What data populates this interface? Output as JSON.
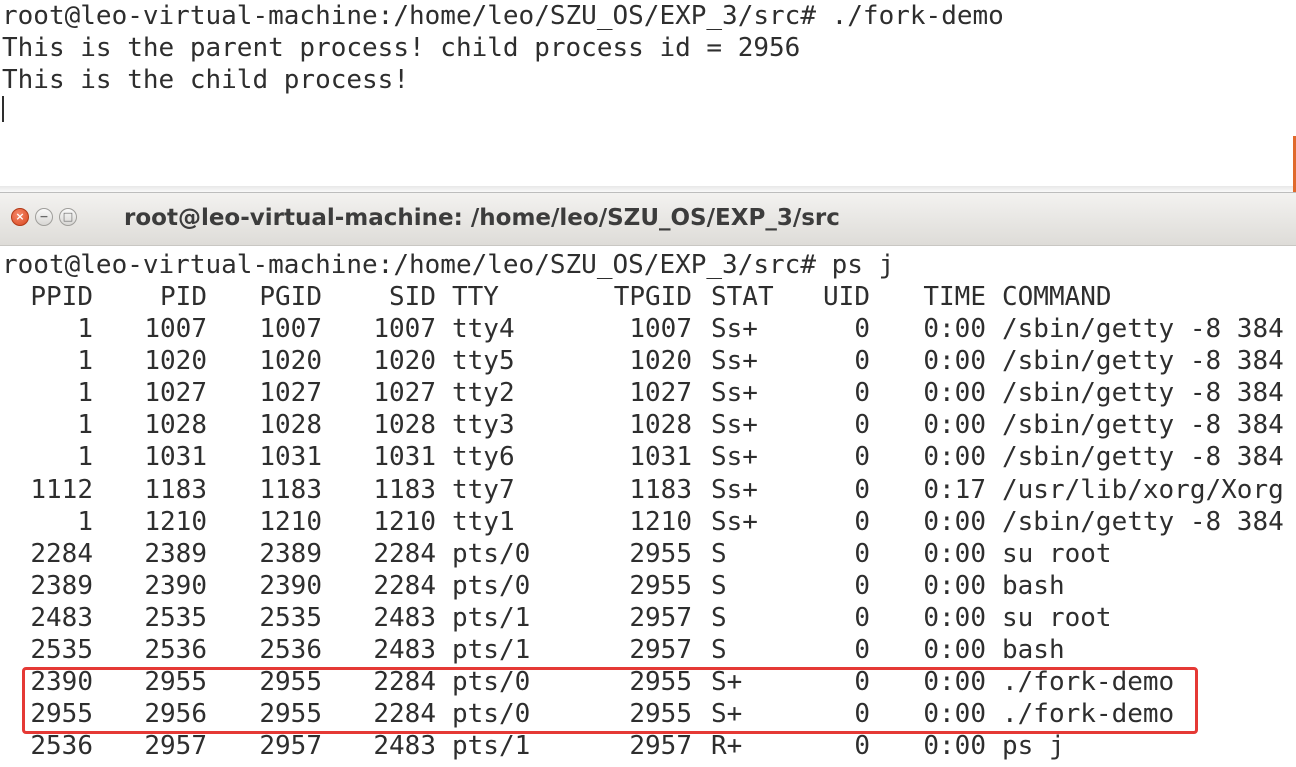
{
  "top_terminal": {
    "lines": [
      "root@leo-virtual-machine:/home/leo/SZU_OS/EXP_3/src# ./fork-demo",
      "This is the parent process! child process id = 2956",
      "This is the child process!"
    ]
  },
  "window": {
    "title": "root@leo-virtual-machine: /home/leo/SZU_OS/EXP_3/src",
    "close_glyph": "×",
    "minimize_glyph": "−",
    "maximize_glyph": "□"
  },
  "terminal": {
    "prompt": "root@leo-virtual-machine:/home/leo/SZU_OS/EXP_3/src# ps j",
    "headers": {
      "ppid": "PPID",
      "pid": "PID",
      "pgid": "PGID",
      "sid": "SID",
      "tty": "TTY",
      "tpgid": "TPGID",
      "stat": "STAT",
      "uid": "UID",
      "time": "TIME",
      "command": "COMMAND"
    },
    "rows": [
      {
        "ppid": "1",
        "pid": "1007",
        "pgid": "1007",
        "sid": "1007",
        "tty": "tty4",
        "tpgid": "1007",
        "stat": "Ss+",
        "uid": "0",
        "time": "0:00",
        "command": "/sbin/getty -8 384"
      },
      {
        "ppid": "1",
        "pid": "1020",
        "pgid": "1020",
        "sid": "1020",
        "tty": "tty5",
        "tpgid": "1020",
        "stat": "Ss+",
        "uid": "0",
        "time": "0:00",
        "command": "/sbin/getty -8 384"
      },
      {
        "ppid": "1",
        "pid": "1027",
        "pgid": "1027",
        "sid": "1027",
        "tty": "tty2",
        "tpgid": "1027",
        "stat": "Ss+",
        "uid": "0",
        "time": "0:00",
        "command": "/sbin/getty -8 384"
      },
      {
        "ppid": "1",
        "pid": "1028",
        "pgid": "1028",
        "sid": "1028",
        "tty": "tty3",
        "tpgid": "1028",
        "stat": "Ss+",
        "uid": "0",
        "time": "0:00",
        "command": "/sbin/getty -8 384"
      },
      {
        "ppid": "1",
        "pid": "1031",
        "pgid": "1031",
        "sid": "1031",
        "tty": "tty6",
        "tpgid": "1031",
        "stat": "Ss+",
        "uid": "0",
        "time": "0:00",
        "command": "/sbin/getty -8 384"
      },
      {
        "ppid": "1112",
        "pid": "1183",
        "pgid": "1183",
        "sid": "1183",
        "tty": "tty7",
        "tpgid": "1183",
        "stat": "Ss+",
        "uid": "0",
        "time": "0:17",
        "command": "/usr/lib/xorg/Xorg"
      },
      {
        "ppid": "1",
        "pid": "1210",
        "pgid": "1210",
        "sid": "1210",
        "tty": "tty1",
        "tpgid": "1210",
        "stat": "Ss+",
        "uid": "0",
        "time": "0:00",
        "command": "/sbin/getty -8 384"
      },
      {
        "ppid": "2284",
        "pid": "2389",
        "pgid": "2389",
        "sid": "2284",
        "tty": "pts/0",
        "tpgid": "2955",
        "stat": "S",
        "uid": "0",
        "time": "0:00",
        "command": "su root"
      },
      {
        "ppid": "2389",
        "pid": "2390",
        "pgid": "2390",
        "sid": "2284",
        "tty": "pts/0",
        "tpgid": "2955",
        "stat": "S",
        "uid": "0",
        "time": "0:00",
        "command": "bash"
      },
      {
        "ppid": "2483",
        "pid": "2535",
        "pgid": "2535",
        "sid": "2483",
        "tty": "pts/1",
        "tpgid": "2957",
        "stat": "S",
        "uid": "0",
        "time": "0:00",
        "command": "su root"
      },
      {
        "ppid": "2535",
        "pid": "2536",
        "pgid": "2536",
        "sid": "2483",
        "tty": "pts/1",
        "tpgid": "2957",
        "stat": "S",
        "uid": "0",
        "time": "0:00",
        "command": "bash"
      },
      {
        "ppid": "2390",
        "pid": "2955",
        "pgid": "2955",
        "sid": "2284",
        "tty": "pts/0",
        "tpgid": "2955",
        "stat": "S+",
        "uid": "0",
        "time": "0:00",
        "command": "./fork-demo"
      },
      {
        "ppid": "2955",
        "pid": "2956",
        "pgid": "2955",
        "sid": "2284",
        "tty": "pts/0",
        "tpgid": "2955",
        "stat": "S+",
        "uid": "0",
        "time": "0:00",
        "command": "./fork-demo"
      },
      {
        "ppid": "2536",
        "pid": "2957",
        "pgid": "2957",
        "sid": "2483",
        "tty": "pts/1",
        "tpgid": "2957",
        "stat": "R+",
        "uid": "0",
        "time": "0:00",
        "command": "ps j"
      }
    ]
  },
  "colors": {
    "text": "#2e2e2e",
    "highlight": "#e53935",
    "close_button": "#d8471f",
    "accent_edge": "#e06a2c"
  }
}
